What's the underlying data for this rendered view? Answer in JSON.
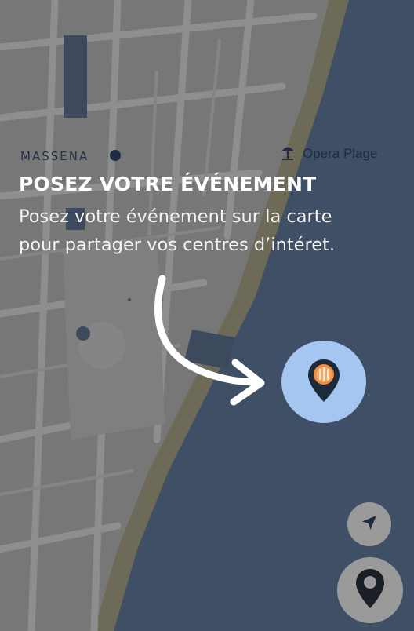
{
  "map": {
    "district_label": "MASSENA",
    "poi_label": "Opera Plage",
    "poi_icon": "beach-umbrella-icon",
    "colors": {
      "land": "#777777",
      "street": "#8e8e8e",
      "water": "#3f4f65",
      "beach": "#6e6a58",
      "dark_poi": "#3d4a5e"
    }
  },
  "onboarding": {
    "title": "POSEZ VOTRE ÉVÉNEMENT",
    "subtitle_line1": "Posez votre événement sur la carte",
    "subtitle_line2": "pour partager vos centres d’intéret.",
    "arrow_icon": "curved-arrow-icon",
    "target_icon": "event-pin-icon",
    "target_color": "#a5c6f0"
  },
  "controls": {
    "locate_icon": "navigation-arrow-icon",
    "place_event_icon": "map-pin-icon",
    "button_color": "#9a9a9a"
  }
}
